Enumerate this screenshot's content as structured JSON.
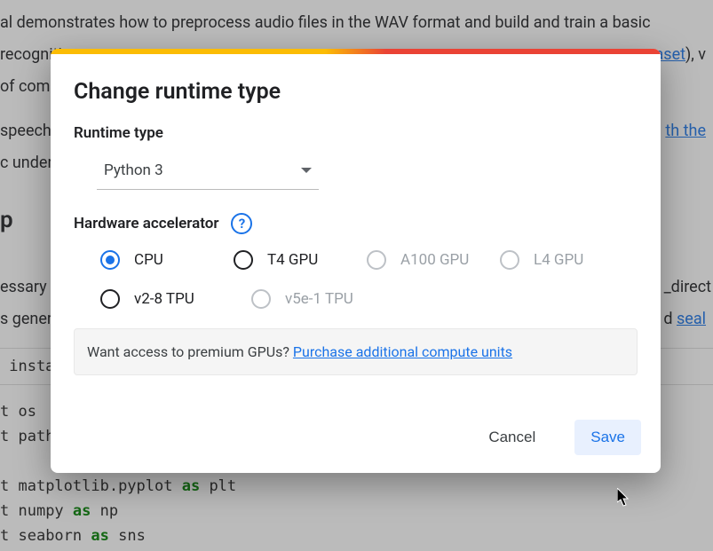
{
  "background": {
    "para1_a": "al demonstrates how to preprocess audio files in the WAV format and build and train a basic",
    "para1_b": " recognition",
    "para1_b_link": "aset",
    "para1_c": " of commands",
    "para2_a": " speech",
    "para2_a_link": "th the",
    "para2_b": "c under",
    "setup": "p",
    "para3_a": "essary",
    "para3_a_tail": "_direct",
    "para3_b": "s generated",
    "para3_b_link": "seal",
    "install": " install",
    "code1_a": "t ",
    "code1_b": "os",
    "code2_a": "t ",
    "code2_b": "path_",
    "code3_a": "t ",
    "code3_b": "matplotlib.pyplot ",
    "code3_c": "as",
    "code3_d": " plt",
    "code4_a": "t ",
    "code4_b": "numpy ",
    "code4_c": "as",
    "code4_d": " np",
    "code5_a": "t ",
    "code5_b": "seaborn ",
    "code5_c": "as",
    "code5_d": " sns"
  },
  "dialog": {
    "title": "Change runtime type",
    "runtime_label": "Runtime type",
    "runtime_value": "Python 3",
    "accel_label": "Hardware accelerator",
    "options": {
      "cpu": "CPU",
      "t4": "T4 GPU",
      "a100": "A100 GPU",
      "l4": "L4 GPU",
      "v2": "v2-8 TPU",
      "v5": "v5e-1 TPU"
    },
    "promo_text": "Want access to premium GPUs? ",
    "promo_link": "Purchase additional compute units",
    "cancel": "Cancel",
    "save": "Save"
  }
}
